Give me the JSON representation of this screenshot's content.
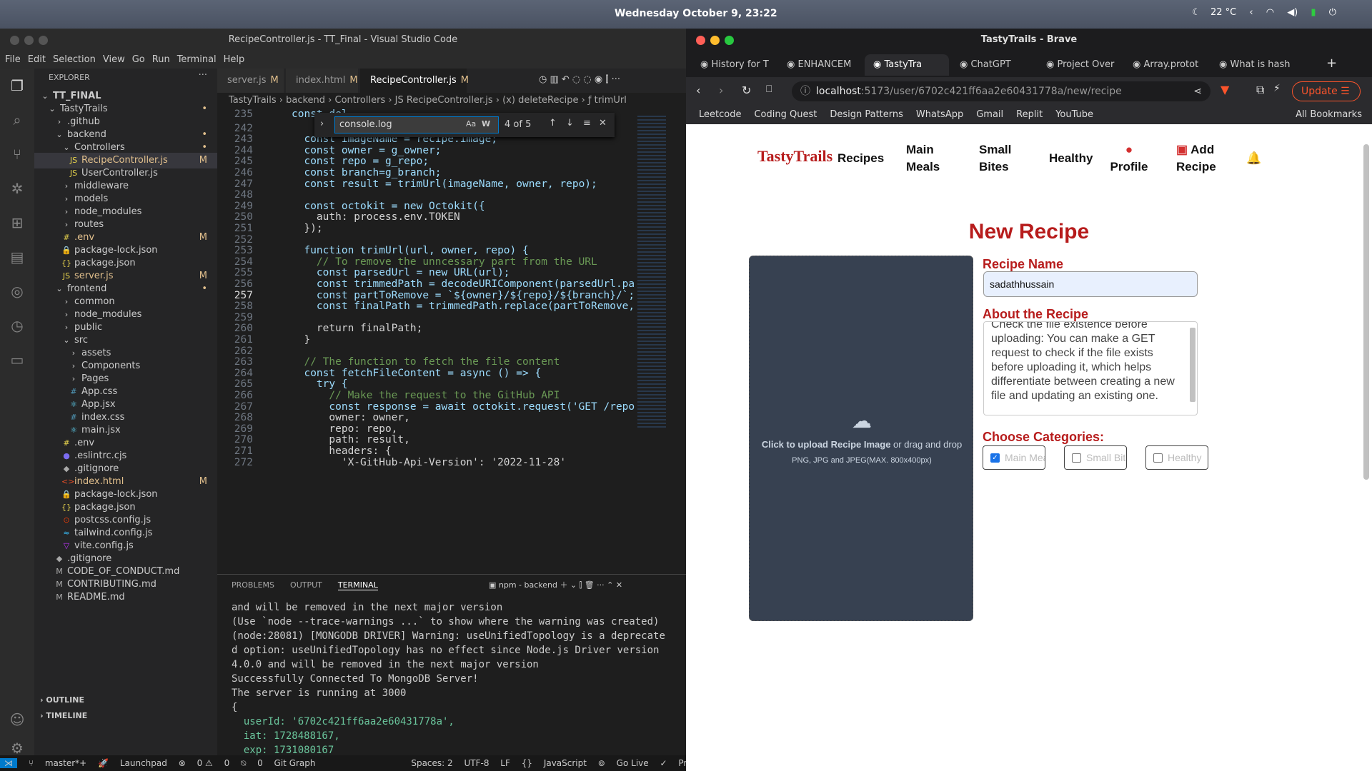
{
  "topbar": {
    "clock": "Wednesday October  9, 23:22",
    "weather": "22 °C"
  },
  "vscode": {
    "title": "RecipeController.js - TT_Final - Visual Studio Code",
    "menu": [
      "File",
      "Edit",
      "Selection",
      "View",
      "Go",
      "Run",
      "Terminal",
      "Help"
    ],
    "explorer_label": "EXPLORER",
    "tree": [
      {
        "label": "TT_FINAL",
        "depth": 0,
        "icon": "chevron",
        "mod": ""
      },
      {
        "label": "TastyTrails",
        "depth": 1,
        "icon": "chevron",
        "mod": "•"
      },
      {
        "label": ".github",
        "depth": 2,
        "icon": "chevron-right",
        "mod": ""
      },
      {
        "label": "backend",
        "depth": 2,
        "icon": "chevron",
        "mod": "•"
      },
      {
        "label": "Controllers",
        "depth": 3,
        "icon": "chevron",
        "mod": "•"
      },
      {
        "label": "RecipeController.js",
        "depth": 4,
        "icon": "js",
        "mod": "M"
      },
      {
        "label": "UserController.js",
        "depth": 4,
        "icon": "js",
        "mod": ""
      },
      {
        "label": "middleware",
        "depth": 3,
        "icon": "chevron-right",
        "mod": ""
      },
      {
        "label": "models",
        "depth": 3,
        "icon": "chevron-right",
        "mod": ""
      },
      {
        "label": "node_modules",
        "depth": 3,
        "icon": "chevron-right",
        "mod": ""
      },
      {
        "label": "routes",
        "depth": 3,
        "icon": "chevron-right",
        "mod": ""
      },
      {
        "label": ".env",
        "depth": 3,
        "icon": "env",
        "mod": "M"
      },
      {
        "label": "package-lock.json",
        "depth": 3,
        "icon": "lock",
        "mod": ""
      },
      {
        "label": "package.json",
        "depth": 3,
        "icon": "json",
        "mod": ""
      },
      {
        "label": "server.js",
        "depth": 3,
        "icon": "js",
        "mod": "M"
      },
      {
        "label": "frontend",
        "depth": 2,
        "icon": "chevron",
        "mod": "•"
      },
      {
        "label": "common",
        "depth": 3,
        "icon": "chevron-right",
        "mod": ""
      },
      {
        "label": "node_modules",
        "depth": 3,
        "icon": "chevron-right",
        "mod": ""
      },
      {
        "label": "public",
        "depth": 3,
        "icon": "chevron-right",
        "mod": ""
      },
      {
        "label": "src",
        "depth": 3,
        "icon": "chevron",
        "mod": ""
      },
      {
        "label": "assets",
        "depth": 4,
        "icon": "chevron-right",
        "mod": ""
      },
      {
        "label": "Components",
        "depth": 4,
        "icon": "chevron-right",
        "mod": ""
      },
      {
        "label": "Pages",
        "depth": 4,
        "icon": "chevron-right",
        "mod": ""
      },
      {
        "label": "App.css",
        "depth": 4,
        "icon": "css",
        "mod": ""
      },
      {
        "label": "App.jsx",
        "depth": 4,
        "icon": "react",
        "mod": ""
      },
      {
        "label": "index.css",
        "depth": 4,
        "icon": "css",
        "mod": ""
      },
      {
        "label": "main.jsx",
        "depth": 4,
        "icon": "react",
        "mod": ""
      },
      {
        "label": ".env",
        "depth": 3,
        "icon": "env",
        "mod": ""
      },
      {
        "label": ".eslintrc.cjs",
        "depth": 3,
        "icon": "eslint",
        "mod": ""
      },
      {
        "label": ".gitignore",
        "depth": 3,
        "icon": "git",
        "mod": ""
      },
      {
        "label": "index.html",
        "depth": 3,
        "icon": "html",
        "mod": "M"
      },
      {
        "label": "package-lock.json",
        "depth": 3,
        "icon": "lock",
        "mod": ""
      },
      {
        "label": "package.json",
        "depth": 3,
        "icon": "json",
        "mod": ""
      },
      {
        "label": "postcss.config.js",
        "depth": 3,
        "icon": "postcss",
        "mod": ""
      },
      {
        "label": "tailwind.config.js",
        "depth": 3,
        "icon": "tailwind",
        "mod": ""
      },
      {
        "label": "vite.config.js",
        "depth": 3,
        "icon": "vite",
        "mod": ""
      },
      {
        "label": ".gitignore",
        "depth": 2,
        "icon": "git",
        "mod": ""
      },
      {
        "label": "CODE_OF_CONDUCT.md",
        "depth": 2,
        "icon": "md",
        "mod": ""
      },
      {
        "label": "CONTRIBUTING.md",
        "depth": 2,
        "icon": "md",
        "mod": ""
      },
      {
        "label": "README.md",
        "depth": 2,
        "icon": "md",
        "mod": ""
      }
    ],
    "outline_label": "OUTLINE",
    "timeline_label": "TIMELINE",
    "tabs": [
      {
        "label": "server.js",
        "mod": "M"
      },
      {
        "label": "index.html",
        "mod": "M"
      },
      {
        "label": "RecipeController.js",
        "mod": "M"
      }
    ],
    "breadcrumb": "TastyTrails › backend › Controllers › JS RecipeController.js › (x) deleteRecipe › ƒ trimUrl",
    "find": {
      "query": "console.log",
      "count": "4 of 5",
      "aa": "Aa",
      "w": "W"
    },
    "code_lines": [
      {
        "n": "235",
        "t": "const del"
      },
      {
        "n": "242",
        "t": ""
      },
      {
        "n": "243",
        "t": "  const imageName = recipe.image;"
      },
      {
        "n": "244",
        "t": "  const owner = g_owner;"
      },
      {
        "n": "245",
        "t": "  const repo = g_repo;"
      },
      {
        "n": "246",
        "t": "  const branch=g_branch;"
      },
      {
        "n": "247",
        "t": "  const result = trimUrl(imageName, owner, repo);"
      },
      {
        "n": "248",
        "t": ""
      },
      {
        "n": "249",
        "t": "  const octokit = new Octokit({"
      },
      {
        "n": "250",
        "t": "    auth: process.env.TOKEN"
      },
      {
        "n": "251",
        "t": "  });"
      },
      {
        "n": "252",
        "t": ""
      },
      {
        "n": "253",
        "t": "  function trimUrl(url, owner, repo) {"
      },
      {
        "n": "254",
        "t": "    // To remove the unncessary part from the URL"
      },
      {
        "n": "255",
        "t": "    const parsedUrl = new URL(url);"
      },
      {
        "n": "256",
        "t": "    const trimmedPath = decodeURIComponent(parsedUrl.pathn"
      },
      {
        "n": "257",
        "t": "    const partToRemove = `${owner}/${repo}/${branch}/`;"
      },
      {
        "n": "258",
        "t": "    const finalPath = trimmedPath.replace(partToRemove, ''"
      },
      {
        "n": "259",
        "t": ""
      },
      {
        "n": "260",
        "t": "    return finalPath;"
      },
      {
        "n": "261",
        "t": "  }"
      },
      {
        "n": "262",
        "t": ""
      },
      {
        "n": "263",
        "t": "  // The function to fetch the file content"
      },
      {
        "n": "264",
        "t": "  const fetchFileContent = async () => {"
      },
      {
        "n": "265",
        "t": "    try {"
      },
      {
        "n": "266",
        "t": "      // Make the request to the GitHub API"
      },
      {
        "n": "267",
        "t": "      const response = await octokit.request('GET /repos/{"
      },
      {
        "n": "268",
        "t": "      owner: owner,"
      },
      {
        "n": "269",
        "t": "      repo: repo,"
      },
      {
        "n": "270",
        "t": "      path: result,"
      },
      {
        "n": "271",
        "t": "      headers: {"
      },
      {
        "n": "272",
        "t": "        'X-GitHub-Api-Version': '2022-11-28'"
      }
    ],
    "panel_tabs": [
      "PROBLEMS",
      "OUTPUT",
      "TERMINAL"
    ],
    "terminal_name": "npm - backend",
    "terminal_lines": [
      "and will be removed in the next major version",
      "(Use `node --trace-warnings ...` to show where the warning was created)",
      "(node:28081) [MONGODB DRIVER] Warning: useUnifiedTopology is a deprecate",
      "d option: useUnifiedTopology has no effect since Node.js Driver version",
      "4.0.0 and will be removed in the next major version",
      "Successfully Connected To MongoDB Server!",
      "The server is running at 3000",
      "{",
      "  userId: '6702c421ff6aa2e60431778a',",
      "  iat: 1728488167,",
      "  exp: 1731080167",
      "}"
    ],
    "status": {
      "branch": "master*+",
      "launchpad": "Launchpad",
      "errors": "0",
      "warnings": "0",
      "ports": "0",
      "git_graph": "Git Graph",
      "spaces": "Spaces: 2",
      "encoding": "UTF-8",
      "eol": "LF",
      "language": "JavaScript",
      "golive": "Go Live",
      "prettier": "Prettier"
    }
  },
  "brave": {
    "title": "TastyTrails - Brave",
    "tabs": [
      "History for T",
      "ENHANCEM",
      "TastyTra",
      "ChatGPT",
      "Project Over",
      "Array.protot",
      "What is hash"
    ],
    "url_host": "localhost",
    "url_rest": ":5173/user/6702c421ff6aa2e60431778a/new/recipe",
    "update_label": "Update",
    "bookmarks": [
      "Leetcode",
      "Coding Quest",
      "Design Patterns",
      "WhatsApp",
      "Gmail",
      "Replit",
      "YouTube"
    ],
    "all_bookmarks": "All Bookmarks"
  },
  "app": {
    "logo": "TastyTrails",
    "nav": {
      "recipes": "Recipes",
      "main_meals": "Main Meals",
      "small_bites": "Small Bites",
      "healthy": "Healthy",
      "profile": "Profile",
      "add_recipe": "Add Recipe"
    },
    "heading": "New Recipe",
    "upload_click": "Click to upload Recipe Image",
    "upload_drag": " or drag and drop",
    "upload_hint": "PNG, JPG and JPEG(MAX. 800x400px)",
    "recipe_name_label": "Recipe Name",
    "recipe_name_value": "sadathhussain",
    "about_label": "About the Recipe",
    "about_value": "Check the file existence before uploading: You can make a GET request to check if the file exists before uploading it, which helps differentiate between creating a new file and updating an existing one.",
    "categories_label": "Choose Categories:",
    "categories": [
      {
        "label": "Main Meal",
        "checked": true
      },
      {
        "label": "Small Bite",
        "checked": false
      },
      {
        "label": "Healthy",
        "checked": false
      }
    ]
  }
}
